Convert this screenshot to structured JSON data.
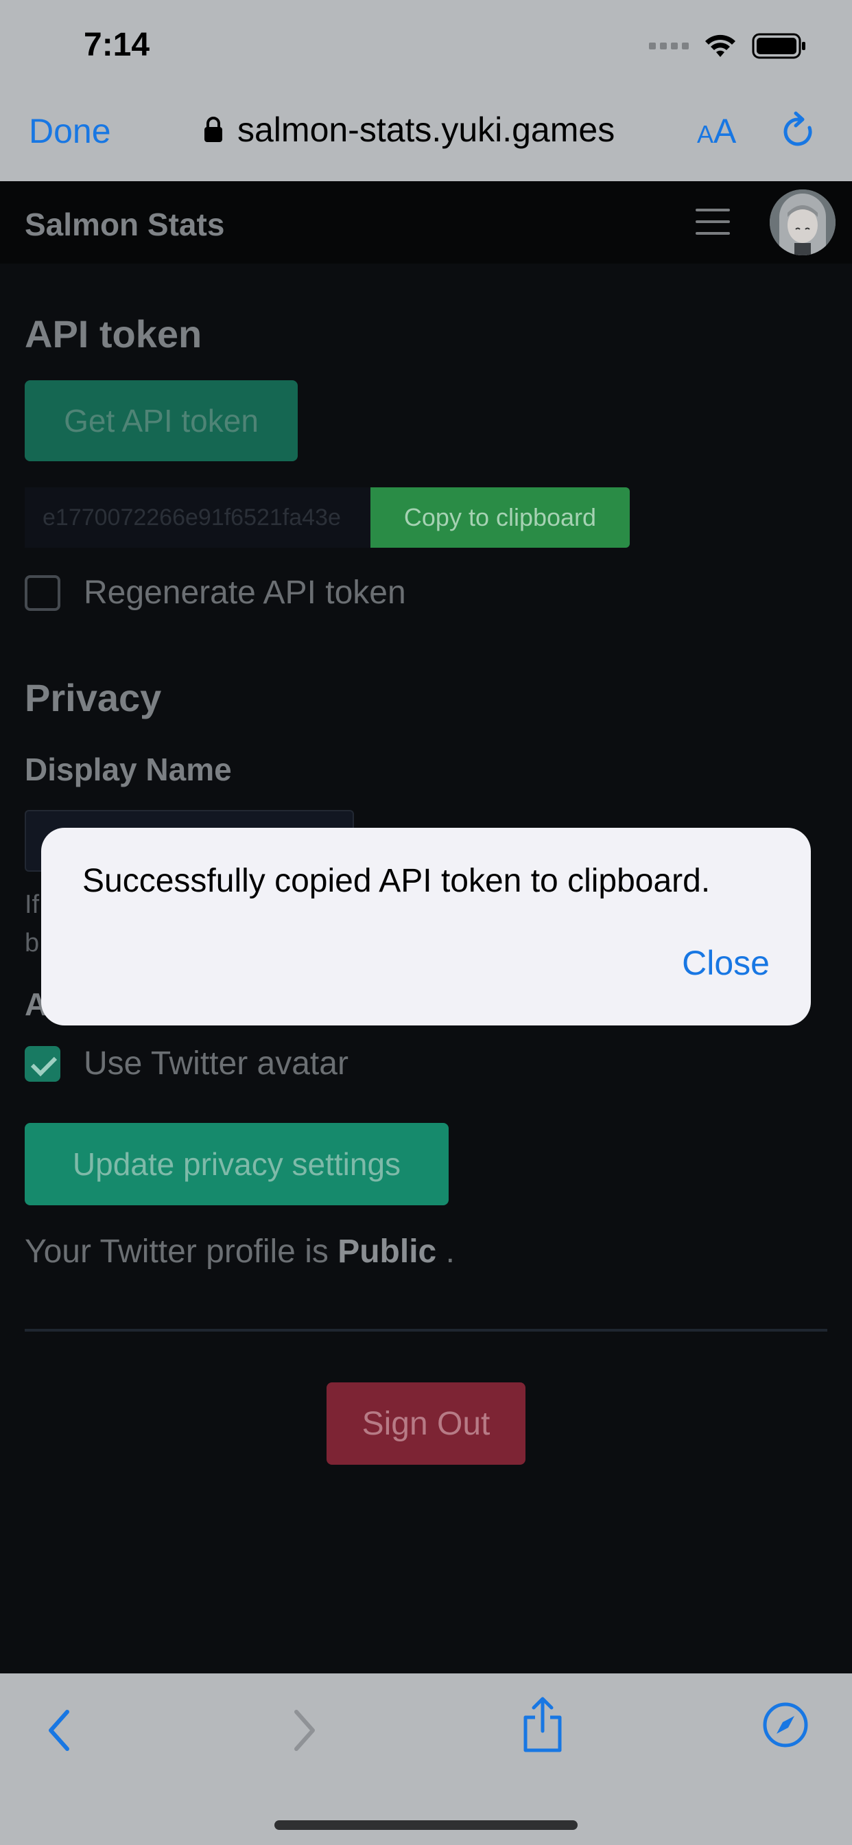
{
  "status_bar": {
    "time": "7:14"
  },
  "browser": {
    "done_label": "Done",
    "url": "salmon-stats.yuki.games",
    "text_size_label_small": "A",
    "text_size_label_large": "A"
  },
  "navbar": {
    "brand": "Salmon Stats"
  },
  "api_token": {
    "heading": "API token",
    "get_button": "Get API token",
    "token_value": "e1770072266e91f6521fa43e",
    "copy_button": "Copy to clipboard",
    "regenerate_label": "Regenerate API token"
  },
  "privacy": {
    "heading": "Privacy",
    "display_name_label": "Display Name",
    "help_line1_prefix": "If",
    "help_line2_prefix": "b",
    "avatar_label_prefix": "A",
    "use_twitter_avatar_label": "Use Twitter avatar",
    "update_button": "Update privacy settings",
    "profile_text_before": "Your Twitter profile is ",
    "profile_visibility": "Public",
    "profile_text_after": " ."
  },
  "sign_out_button": "Sign Out",
  "dialog": {
    "message": "Successfully copied API token to clipboard.",
    "close_label": "Close"
  },
  "icons": {
    "back": "chevron-left-icon",
    "forward": "chevron-right-icon",
    "share": "share-icon",
    "safari": "compass-icon"
  }
}
